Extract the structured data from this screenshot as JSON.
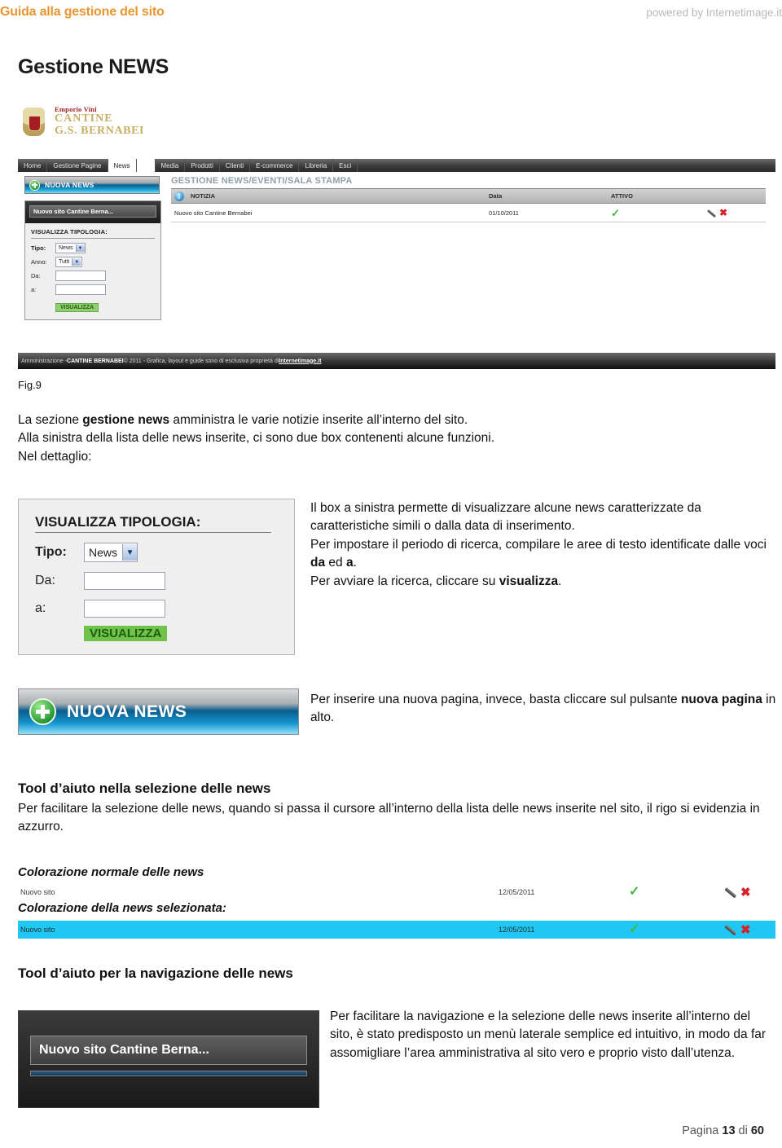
{
  "header": {
    "left_title": "Guida alla gestione del sito",
    "right_credit": "powered by Internetimage.it"
  },
  "page_title": "Gestione NEWS",
  "screenshot": {
    "logo": {
      "line1": "Emporio Vini",
      "line2": "CANTINE",
      "line3": "G.S. BERNABEI"
    },
    "nav": [
      {
        "label": "Home",
        "active": false
      },
      {
        "label": "Gestione Pagine",
        "active": false
      },
      {
        "label": "News",
        "active": true
      },
      {
        "label": "Media",
        "active": false
      },
      {
        "label": "Prodotti",
        "active": false
      },
      {
        "label": "Clienti",
        "active": false
      },
      {
        "label": "E-commerce",
        "active": false
      },
      {
        "label": "Libreria",
        "active": false
      },
      {
        "label": "Esci",
        "active": false
      }
    ],
    "new_button_label": "NUOVA NEWS",
    "side_menu_item": "Nuovo sito Cantine Berna...",
    "filter_panel": {
      "title": "VISUALIZZA TIPOLOGIA:",
      "tipo_label": "Tipo:",
      "tipo_value": "News",
      "anno_label": "Anno:",
      "anno_value": "Tutti",
      "da_label": "Da:",
      "da_value": "",
      "a_label": "a:",
      "a_value": "",
      "submit_label": "VISUALIZZA"
    },
    "main_heading": "GESTIONE NEWS/EVENTI/SALA STAMPA",
    "table": {
      "columns": [
        "NOTIZIA",
        "Data",
        "ATTIVO"
      ],
      "rows": [
        {
          "notizia": "Nuovo sito Cantine Bernabei",
          "data": "01/10/2011",
          "attivo": "✓"
        }
      ]
    },
    "footer": {
      "part1": "Amministrazione - ",
      "part2": "CANTINE BERNABEI",
      "part3": " © 2011 - Grafica, layout e guide sono di esclusiva proprietà di ",
      "part4": "Internetimage.it"
    }
  },
  "fig_label": "Fig.9",
  "intro": {
    "l1a": "La sezione ",
    "l1b": "gestione news",
    "l1c": " amministra le varie notizie inserite all’interno del sito.",
    "l2": "Alla sinistra della lista delle news inserite, ci sono due box contenenti alcune funzioni.",
    "l3": "Nel dettaglio:"
  },
  "detail_box": {
    "title": "VISUALIZZA TIPOLOGIA:",
    "tipo_label": "Tipo:",
    "tipo_value": "News",
    "da_label": "Da:",
    "da_value": "",
    "a_label": "a:",
    "a_value": "",
    "submit_label": "VISUALIZZA"
  },
  "box_text": {
    "l1": "Il box a sinistra permette di visualizzare alcune news caratterizzate da caratteristiche simili o dalla data di inserimento.",
    "l2a": "Per impostare il periodo di ricerca, compilare le aree di testo identificate dalle voci ",
    "l2b": "da",
    "l2c": " ed ",
    "l2d": "a",
    "l2e": ".",
    "l3a": "Per avviare la ricerca, cliccare su ",
    "l3b": "visualizza",
    "l3c": "."
  },
  "nuova_news": {
    "button_label": "NUOVA NEWS",
    "text_a": "Per inserire una nuova pagina, invece, basta cliccare sul pulsante ",
    "text_b": "nuova pagina",
    "text_c": " in alto."
  },
  "section_selection": {
    "title": "Tool d’aiuto nella selezione delle news",
    "body": "Per facilitare la selezione delle news, quando si passa il cursore all’interno della lista delle news inserite nel sito, il rigo si evidenzia in azzurro."
  },
  "demo_rows": {
    "normal_label": "Colorazione normale delle news",
    "selected_label": "Colorazione della news selezionata:",
    "normal": {
      "name": "Nuovo sito",
      "date": "12/05/2011"
    },
    "selected": {
      "name": "Nuovo sito",
      "date": "12/05/2011"
    },
    "highlight_color": "#1FC8F2"
  },
  "section_navigation": {
    "title": "Tool d’aiuto per la navigazione delle news",
    "menu_item": "Nuovo sito Cantine Berna...",
    "body": "Per facilitare la navigazione e la selezione delle news inserite all’interno del sito, è stato predisposto un menù laterale semplice ed intuitivo, in modo da far assomigliare l’area amministrativa al sito vero e proprio visto dall’utenza."
  },
  "page_footer": {
    "prefix": "Pagina ",
    "number": "13",
    "middle": " di ",
    "total": "60"
  }
}
